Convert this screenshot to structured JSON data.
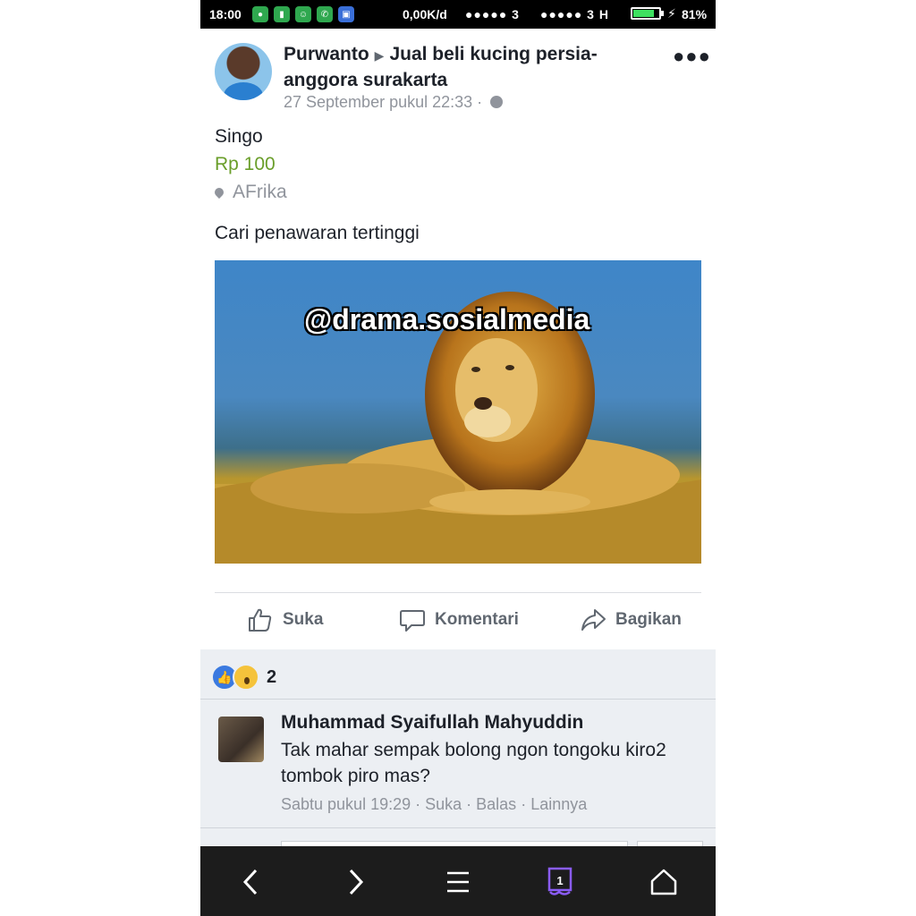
{
  "status_bar": {
    "time": "18:00",
    "net_speed": "0,00K/d",
    "signal1": "●●●●● 3",
    "signal2": "●●●●● 3 H",
    "battery_percent": "81%",
    "battery_level": 0.81
  },
  "post": {
    "author": "Purwanto",
    "group": "Jual beli kucing persia-anggora surakarta",
    "timestamp": "27 September pukul 22:33 ·",
    "item_title": "Singo",
    "item_price": "Rp 100",
    "item_location": "AFrika",
    "text": "Cari penawaran tertinggi",
    "image_watermark": "@drama.sosialmedia"
  },
  "actions": {
    "like": "Suka",
    "comment": "Komentari",
    "share": "Bagikan"
  },
  "reactions": {
    "count": "2",
    "types": [
      "like-icon",
      "wow-icon"
    ]
  },
  "comment": {
    "author": "Muhammad Syaifullah Mahyuddin",
    "text": "Tak mahar sempak bolong ngon tongoku kiro2 tombok piro mas?",
    "time": "Sabtu pukul 19:29",
    "like": "Suka",
    "reply": "Balas",
    "more": "Lainnya"
  },
  "navbar": {
    "tabs_count": "1"
  },
  "colors": {
    "price": "#6a9e2a",
    "like_blue": "#3b7ae0",
    "tabs_accent": "#8a5cf6"
  }
}
